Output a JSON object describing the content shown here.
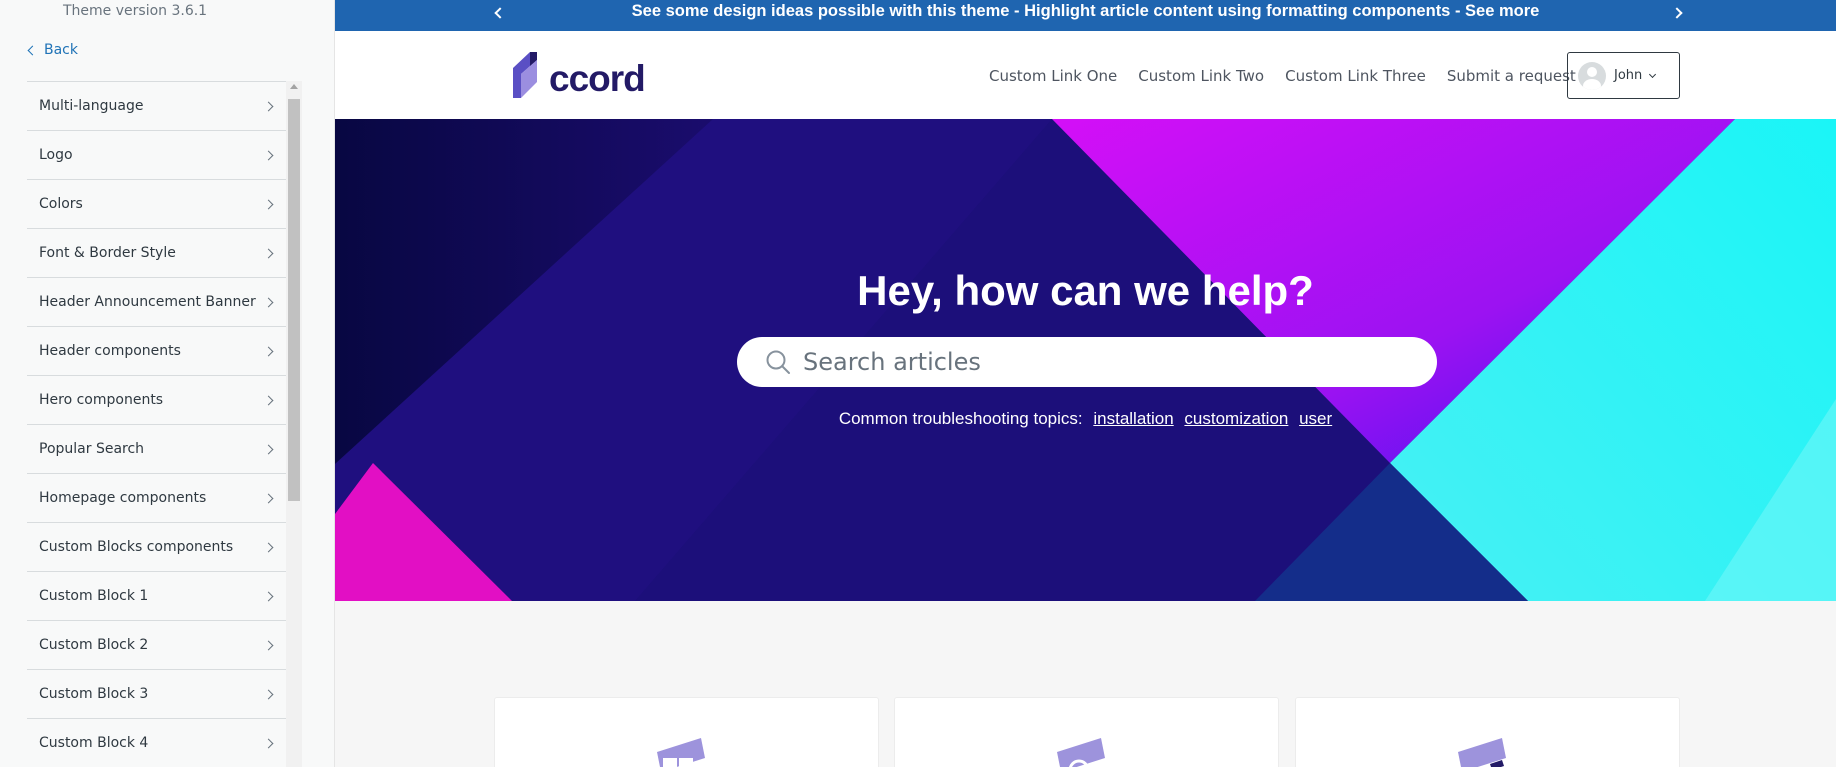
{
  "panel": {
    "version": "Theme version 3.6.1",
    "back_label": "Back",
    "items": [
      {
        "label": "Multi-language"
      },
      {
        "label": "Logo"
      },
      {
        "label": "Colors"
      },
      {
        "label": "Font & Border Style"
      },
      {
        "label": "Header Announcement Banner"
      },
      {
        "label": "Header components"
      },
      {
        "label": "Hero components"
      },
      {
        "label": "Popular Search"
      },
      {
        "label": "Homepage components"
      },
      {
        "label": "Custom Blocks components"
      },
      {
        "label": "Custom Block 1"
      },
      {
        "label": "Custom Block 2"
      },
      {
        "label": "Custom Block 3"
      },
      {
        "label": "Custom Block 4"
      }
    ]
  },
  "announcement": {
    "text": "See some design ideas possible with this theme - Highlight article content using formatting components - See more"
  },
  "header": {
    "logo_text": "ccord",
    "nav": [
      "Custom Link One",
      "Custom Link Two",
      "Custom Link Three",
      "Submit a request"
    ],
    "user_name": "John"
  },
  "hero": {
    "title": "Hey, how can we help?",
    "search_placeholder": "Search articles",
    "topics_label": "Common troubleshooting topics:",
    "topics": [
      "installation",
      "customization",
      "user"
    ]
  },
  "colors": {
    "accent": "#1f65b0",
    "brand": "#231a66",
    "hero_base": "#1c0f7a",
    "magenta": "#e20fc4",
    "cyan": "#2ef5f5"
  }
}
